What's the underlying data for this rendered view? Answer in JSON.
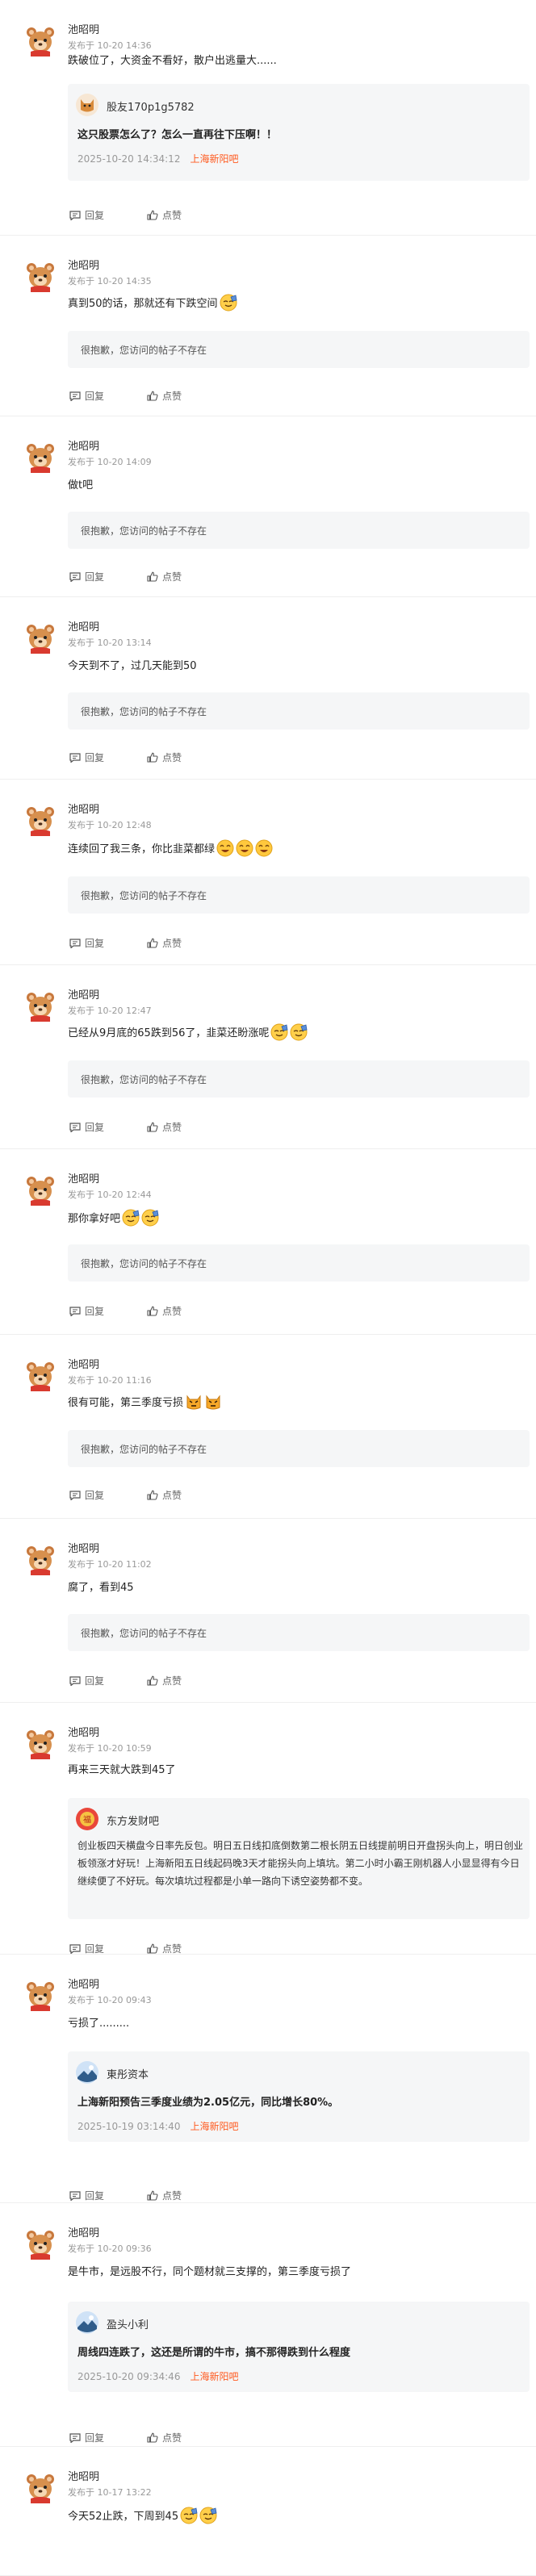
{
  "posts": [
    {
      "username": "池昭明",
      "time": "发布于 10-20 14:36",
      "text": "跌破位了，大资金不看好，散户出逃量大......",
      "emoji": [],
      "quote": {
        "type": "reply",
        "author": "股友170p1g5782",
        "author_icon": "cat-avatar-icon",
        "text": "这只股票怎么了？怎么一直再往下压啊！！",
        "date": "2025-10-20 14:34:12",
        "source": "上海新阳吧"
      },
      "reply_label": "回复",
      "like_label": "点赞"
    },
    {
      "username": "池昭明",
      "time": "发布于 10-20 14:35",
      "text": "真到50的话，那就还有下跌空间",
      "emoji": [
        "facepalm"
      ],
      "quote": {
        "type": "missing",
        "text": "很抱歉，您访问的帖子不存在"
      },
      "reply_label": "回复",
      "like_label": "点赞"
    },
    {
      "username": "池昭明",
      "time": "发布于 10-20 14:09",
      "text": "做t吧",
      "emoji": [],
      "quote": {
        "type": "missing",
        "text": "很抱歉，您访问的帖子不存在"
      },
      "reply_label": "回复",
      "like_label": "点赞"
    },
    {
      "username": "池昭明",
      "time": "发布于 10-20 13:14",
      "text": "今天到不了，过几天能到50",
      "emoji": [],
      "quote": {
        "type": "missing",
        "text": "很抱歉，您访问的帖子不存在"
      },
      "reply_label": "回复",
      "like_label": "点赞"
    },
    {
      "username": "池昭明",
      "time": "发布于 10-20 12:48",
      "text": "连续回了我三条，你比韭菜都绿",
      "emoji": [
        "laugh",
        "laugh",
        "laugh"
      ],
      "quote": {
        "type": "missing",
        "text": "很抱歉，您访问的帖子不存在"
      },
      "reply_label": "回复",
      "like_label": "点赞"
    },
    {
      "username": "池昭明",
      "time": "发布于 10-20 12:47",
      "text": "已经从9月底的65跌到56了，韭菜还盼涨呢",
      "emoji": [
        "facepalm",
        "facepalm"
      ],
      "quote": {
        "type": "missing",
        "text": "很抱歉，您访问的帖子不存在"
      },
      "reply_label": "回复",
      "like_label": "点赞"
    },
    {
      "username": "池昭明",
      "time": "发布于 10-20 12:44",
      "text": "那你拿好吧",
      "emoji": [
        "facepalm",
        "facepalm"
      ],
      "quote": {
        "type": "missing",
        "text": "很抱歉，您访问的帖子不存在"
      },
      "reply_label": "回复",
      "like_label": "点赞"
    },
    {
      "username": "池昭明",
      "time": "发布于 10-20 11:16",
      "text": "很有可能，第三季度亏损",
      "emoji": [
        "angry",
        "angry"
      ],
      "quote": {
        "type": "missing",
        "text": "很抱歉，您访问的帖子不存在"
      },
      "reply_label": "回复",
      "like_label": "点赞"
    },
    {
      "username": "池昭明",
      "time": "发布于 10-20 11:02",
      "text": "腐了，看到45",
      "emoji": [],
      "quote": {
        "type": "missing",
        "text": "很抱歉，您访问的帖子不存在"
      },
      "reply_label": "回复",
      "like_label": "点赞"
    },
    {
      "username": "池昭明",
      "time": "发布于 10-20 10:59",
      "text": "再来三天就大跌到45了",
      "emoji": [],
      "quote": {
        "type": "article",
        "author": "东方发财吧",
        "author_icon": "fortune-avatar-icon",
        "text": "创业板四天横盘今日率先反包。明日五日线扣底倒数第二根长阴五日线提前明日开盘拐头向上，明日创业板领涨才好玩！上海新阳五日线起码晚3天才能拐头向上填坑。第二小时小霸王刚机器人小显显得有今日继续便了不好玩。每次填坑过程都是小单一路向下诱空姿势都不变。"
      },
      "reply_label": "回复",
      "like_label": "点赞"
    },
    {
      "username": "池昭明",
      "time": "发布于 10-20 09:43",
      "text": "亏损了.........",
      "emoji": [],
      "quote": {
        "type": "reply",
        "author": "東彤资本",
        "author_icon": "landscape-avatar-icon",
        "text": "上海新阳预告三季度业绩为2.05亿元，同比增长80%。",
        "date": "2025-10-19 03:14:40",
        "source": "上海新阳吧"
      },
      "reply_label": "回复",
      "like_label": "点赞"
    },
    {
      "username": "池昭明",
      "time": "发布于 10-20 09:36",
      "text": "是牛市，是远股不行，同个题材就三支撑的，第三季度亏损了",
      "emoji": [],
      "quote": {
        "type": "reply",
        "author": "盈头小利",
        "author_icon": "landscape-avatar-icon",
        "text": "周线四连跌了，这还是所谓的牛市，搞不那得跌到什么程度",
        "date": "2025-10-20 09:34:46",
        "source": "上海新阳吧"
      },
      "reply_label": "回复",
      "like_label": "点赞"
    },
    {
      "username": "池昭明",
      "time": "发布于 10-17 13:22",
      "text": "今天52止跌，下周到45",
      "emoji": [
        "facepalm",
        "facepalm"
      ],
      "quote": null,
      "reply_label": "回复",
      "like_label": "点赞"
    }
  ],
  "colors": {
    "source_link": "#ff5a1f",
    "meta_gray": "#999999",
    "quote_bg": "#f5f6f7"
  }
}
